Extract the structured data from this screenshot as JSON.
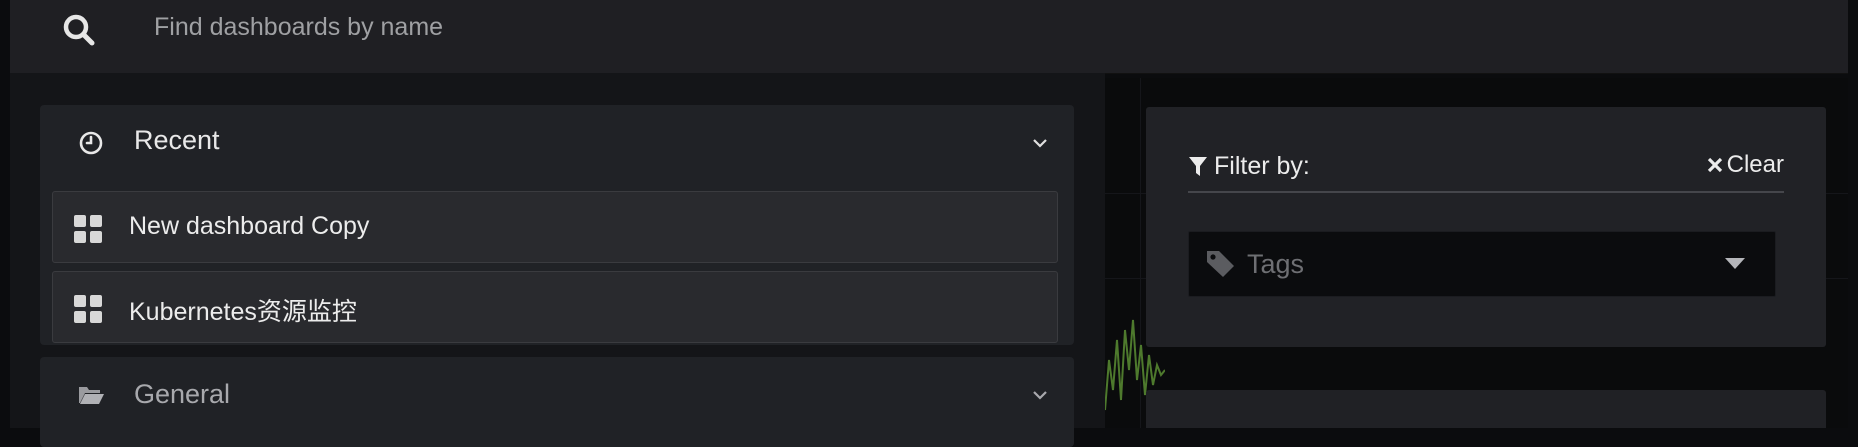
{
  "search": {
    "placeholder": "Find dashboards by name"
  },
  "sections": [
    {
      "title": "Recent",
      "icon": "clock-icon",
      "items": [
        {
          "label": "New dashboard Copy",
          "icon": "dashboard-grid-icon"
        },
        {
          "label": "Kubernetes资源监控",
          "icon": "dashboard-grid-icon"
        }
      ]
    },
    {
      "title": "General",
      "icon": "folder-open-icon"
    }
  ],
  "filter": {
    "label": "Filter by:",
    "clear_label": "Clear",
    "tags_placeholder": "Tags"
  },
  "colors": {
    "panel": "#202226",
    "item": "#292a2e",
    "search_bar": "#1f1f23",
    "spark_line": "#4e7a2d"
  }
}
